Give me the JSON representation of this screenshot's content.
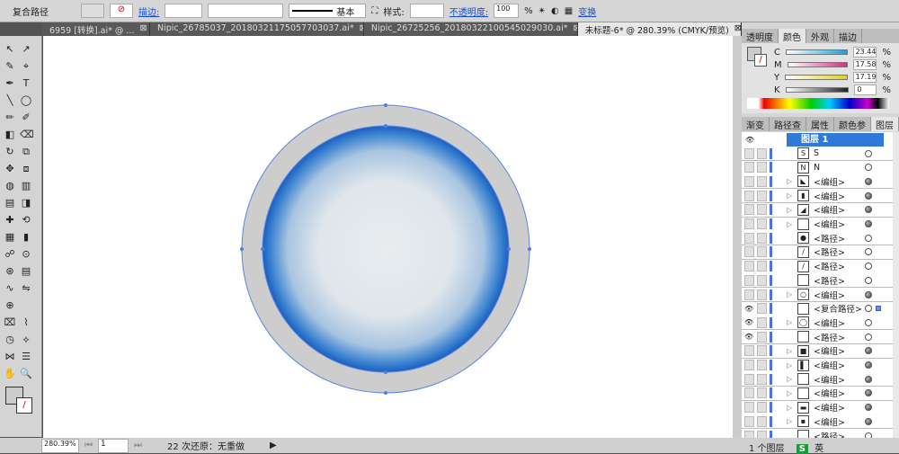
{
  "control_bar": {
    "object_type": "复合路径",
    "stroke_label": "描边:",
    "stroke_profile": "基本",
    "style_label": "样式:",
    "opacity_label": "不透明度:",
    "opacity_value": "100",
    "opacity_unit": "%",
    "transform_label": "变换"
  },
  "tabs": [
    {
      "label": "6959 [转换].ai* @ ...",
      "active": false
    },
    {
      "label": "Nipic_26785037_20180321175057703037.ai*",
      "active": false
    },
    {
      "label": "Nipic_26725256_20180322100545029030.ai*",
      "active": false
    },
    {
      "label": "未标题-6* @ 280.39% (CMYK/预览)",
      "active": true
    }
  ],
  "color_panel": {
    "tabs": [
      "透明度",
      "颜色",
      "外观",
      "描边"
    ],
    "active_tab": "颜色",
    "sliders": [
      {
        "channel": "C",
        "value": "23.44",
        "color": "#1aa0d8"
      },
      {
        "channel": "M",
        "value": "17.58",
        "color": "#d0307a"
      },
      {
        "channel": "Y",
        "value": "17.19",
        "color": "#e0d020"
      },
      {
        "channel": "K",
        "value": "0",
        "color": "#222222"
      }
    ],
    "unit": "%"
  },
  "layers_panel": {
    "tabs": [
      "渐变",
      "路径查",
      "属性",
      "颜色参",
      "图层"
    ],
    "active_tab": "图层",
    "layer_name": "图层 1",
    "items": [
      {
        "name": "S",
        "thumb": "S",
        "expand": false,
        "filled": false,
        "eye": false
      },
      {
        "name": "N",
        "thumb": "N",
        "expand": false,
        "filled": false,
        "eye": false
      },
      {
        "name": "<编组>",
        "thumb": "◣",
        "expand": true,
        "filled": true,
        "eye": false
      },
      {
        "name": "<编组>",
        "thumb": "▮",
        "expand": true,
        "filled": true,
        "eye": false
      },
      {
        "name": "<编组>",
        "thumb": "◢",
        "expand": true,
        "filled": true,
        "eye": false
      },
      {
        "name": "<编组>",
        "thumb": "",
        "expand": true,
        "filled": true,
        "eye": false
      },
      {
        "name": "<路径>",
        "thumb": "●",
        "expand": false,
        "filled": false,
        "eye": false
      },
      {
        "name": "<路径>",
        "thumb": "/",
        "expand": false,
        "filled": false,
        "eye": false
      },
      {
        "name": "<路径>",
        "thumb": "/",
        "expand": false,
        "filled": false,
        "eye": false
      },
      {
        "name": "<路径>",
        "thumb": "",
        "expand": false,
        "filled": false,
        "eye": false
      },
      {
        "name": "<编组>",
        "thumb": "○",
        "expand": true,
        "filled": true,
        "eye": false
      },
      {
        "name": "<复合路径>",
        "thumb": "",
        "expand": false,
        "filled": false,
        "eye": true,
        "selected": true
      },
      {
        "name": "<编组>",
        "thumb": "◯",
        "expand": true,
        "filled": false,
        "eye": true
      },
      {
        "name": "<路径>",
        "thumb": "",
        "expand": false,
        "filled": false,
        "eye": true
      },
      {
        "name": "<编组>",
        "thumb": "■",
        "expand": true,
        "filled": true,
        "eye": false
      },
      {
        "name": "<编组>",
        "thumb": "▌",
        "expand": true,
        "filled": true,
        "eye": false
      },
      {
        "name": "<编组>",
        "thumb": "",
        "expand": true,
        "filled": true,
        "eye": false
      },
      {
        "name": "<编组>",
        "thumb": "",
        "expand": true,
        "filled": true,
        "eye": false
      },
      {
        "name": "<编组>",
        "thumb": "▬",
        "expand": true,
        "filled": true,
        "eye": false
      },
      {
        "name": "<编组>",
        "thumb": "▪",
        "expand": true,
        "filled": true,
        "eye": false
      },
      {
        "name": "<路径>",
        "thumb": "",
        "expand": false,
        "filled": false,
        "eye": false
      }
    ],
    "footer": "1 个图层"
  },
  "status_bar": {
    "zoom": "280.39%",
    "artboard": "1",
    "undo_info": "22 次还原：无重做"
  },
  "ime": {
    "label": "英"
  },
  "colors": {
    "accent": "#2f7ad8",
    "ring": "#cdcdcd",
    "selection": "#4a7fe0"
  }
}
